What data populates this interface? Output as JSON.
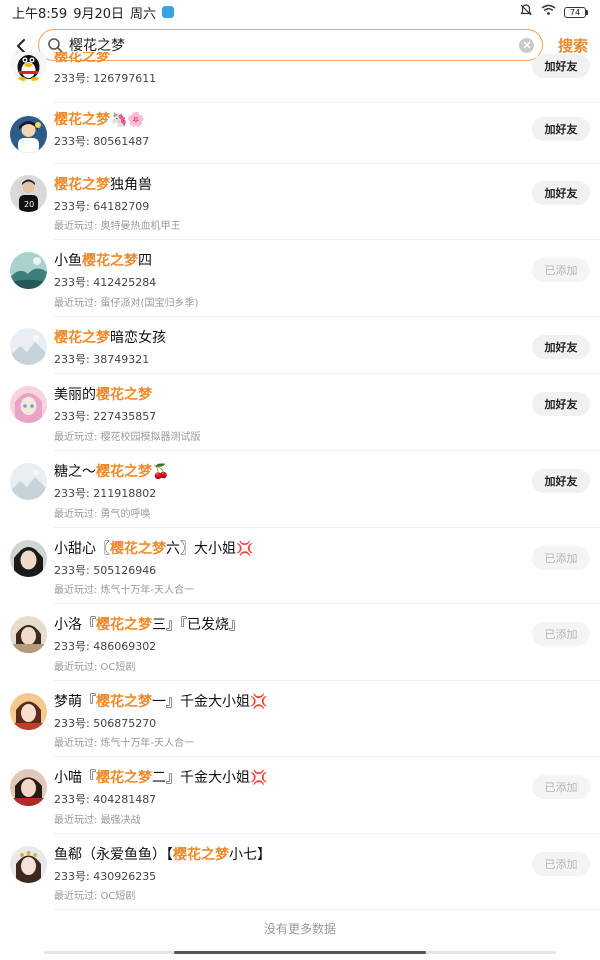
{
  "status_bar": {
    "time": "上午8:59",
    "date": "9月20日",
    "weekday": "周六",
    "battery": "74"
  },
  "search": {
    "query": "樱花之梦",
    "search_label": "搜索"
  },
  "colors": {
    "accent": "#ef8a2d",
    "search_border": "#f2a45c"
  },
  "users": [
    {
      "name_before": "",
      "name_highlight": "樱花之梦",
      "name_after": "",
      "uid": "233号: 126797611",
      "recent": "",
      "action": "加好友",
      "avatar": "penguin-avatar"
    },
    {
      "name_before": "",
      "name_highlight": "樱花之梦",
      "name_after": "🦄🌸",
      "uid": "233号: 80561487",
      "recent": "",
      "action": "加好友",
      "avatar": "anime-avatar"
    },
    {
      "name_before": "",
      "name_highlight": "樱花之梦",
      "name_after": "独角兽",
      "uid": "233号: 64182709",
      "recent": "最近玩过: 奥特曼热血机甲王",
      "action": "加好友",
      "avatar": "person-avatar"
    },
    {
      "name_before": "小鱼",
      "name_highlight": "樱花之梦",
      "name_after": "四",
      "uid": "233号: 412425284",
      "recent": "最近玩过: 蛋仔派对(国宝归乡季)",
      "action": "已添加",
      "avatar": "landscape-avatar"
    },
    {
      "name_before": "",
      "name_highlight": "樱花之梦",
      "name_after": "暗恋女孩",
      "uid": "233号: 38749321",
      "recent": "",
      "action": "加好友",
      "avatar": "default-avatar"
    },
    {
      "name_before": "美丽的",
      "name_highlight": "樱花之梦",
      "name_after": "",
      "uid": "233号: 227435857",
      "recent": "最近玩过: 樱花校园模拟器测试版",
      "action": "加好友",
      "avatar": "anime-girl-avatar"
    },
    {
      "name_before": "糖之～",
      "name_highlight": "樱花之梦",
      "name_after": "🍒",
      "uid": "233号: 211918802",
      "recent": "最近玩过: 勇气的呼唤",
      "action": "加好友",
      "avatar": "default-avatar"
    },
    {
      "name_before": "小甜心〖",
      "name_highlight": "樱花之梦",
      "name_after": "六〗大小姐💢",
      "uid": "233号: 505126946",
      "recent": "最近玩过: 炼气十万年-天人合一",
      "action": "已添加",
      "avatar": "girl-avatar"
    },
    {
      "name_before": "小洛『",
      "name_highlight": "樱花之梦",
      "name_after": "三』『已发烧』",
      "uid": "233号: 486069302",
      "recent": "最近玩过: OC短剧",
      "action": "已添加",
      "avatar": "girl-avatar"
    },
    {
      "name_before": "梦萌『",
      "name_highlight": "樱花之梦",
      "name_after": "一』千金大小姐💢",
      "uid": "233号: 506875270",
      "recent": "最近玩过: 炼气十万年-天人合一",
      "action": "",
      "avatar": "girl-avatar"
    },
    {
      "name_before": "小喵『",
      "name_highlight": "樱花之梦",
      "name_after": "二』千金大小姐💢",
      "uid": "233号: 404281487",
      "recent": "最近玩过: 最强决战",
      "action": "已添加",
      "avatar": "girl-avatar"
    },
    {
      "name_before": "鱼郗（永爱鱼鱼）【",
      "name_highlight": "樱花之梦",
      "name_after": "小七】",
      "uid": "233号: 430926235",
      "recent": "最近玩过: OC短剧",
      "action": "已添加",
      "avatar": "girl-avatar"
    }
  ],
  "footer": {
    "no_more": "没有更多数据"
  }
}
